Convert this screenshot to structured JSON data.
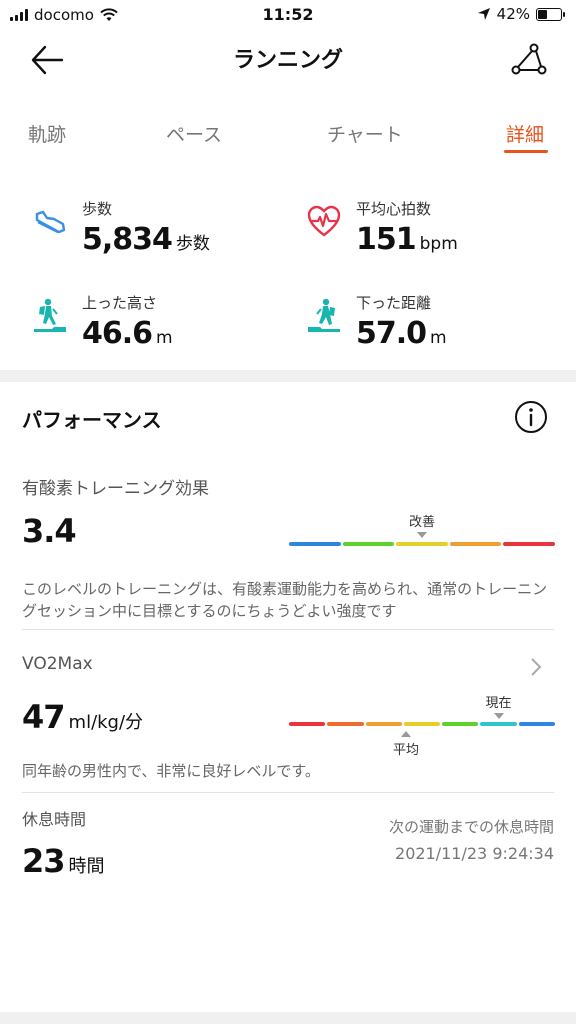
{
  "status_bar": {
    "carrier": "docomo",
    "time": "11:52",
    "battery_percent": "42%",
    "battery_level": 0.42
  },
  "header": {
    "title": "ランニング",
    "back_icon": "arrow-left-icon",
    "route_icon": "route-share-icon"
  },
  "tabs": [
    {
      "label": "軌跡",
      "active": false
    },
    {
      "label": "ペース",
      "active": false
    },
    {
      "label": "チャート",
      "active": false
    },
    {
      "label": "詳細",
      "active": true
    }
  ],
  "accent_color": "#e8531e",
  "metrics": {
    "steps": {
      "label": "歩数",
      "value": "5,834",
      "unit": "歩数",
      "icon": "shoe-icon",
      "icon_color": "#3a8ee6"
    },
    "heart_rate": {
      "label": "平均心拍数",
      "value": "151",
      "unit": "bpm",
      "icon": "heart-rate-icon",
      "icon_color": "#e8344a"
    },
    "ascent": {
      "label": "上った高さ",
      "value": "46.6",
      "unit": "m",
      "icon": "hiker-up-icon",
      "icon_color": "#19b6b0"
    },
    "descent": {
      "label": "下った距離",
      "value": "57.0",
      "unit": "m",
      "icon": "hiker-down-icon",
      "icon_color": "#19b6b0"
    }
  },
  "performance": {
    "title": "パフォーマンス",
    "info_icon": "info-icon",
    "aerobic": {
      "label": "有酸素トレーニング効果",
      "value": "3.4",
      "marker_label": "改善",
      "marker_segment": 2,
      "segment_colors": [
        "#2e86de",
        "#5fd12b",
        "#e6cf2a",
        "#f0a030",
        "#e8343a"
      ],
      "description": "このレベルのトレーニングは、有酸素運動能力を高められ、通常のトレーニングセッション中に目標とするのにちょうどよい強度です"
    },
    "vo2max": {
      "label": "VO2Max",
      "value": "47",
      "unit": "ml/kg/分",
      "current_label": "現在",
      "average_label": "平均",
      "current_segment": 5,
      "average_segment": 3,
      "segment_colors": [
        "#e8343a",
        "#f06a30",
        "#f0a030",
        "#e6cf2a",
        "#5fd12b",
        "#2ec4d4",
        "#2e86de"
      ],
      "description": "同年齢の男性内で、非常に良好レベルです。",
      "chevron_icon": "chevron-right-icon"
    },
    "rest": {
      "label": "休息時間",
      "value": "23",
      "unit": "時間",
      "next_label": "次の運動までの休息時間",
      "next_time": "2021/11/23 9:24:34"
    }
  }
}
